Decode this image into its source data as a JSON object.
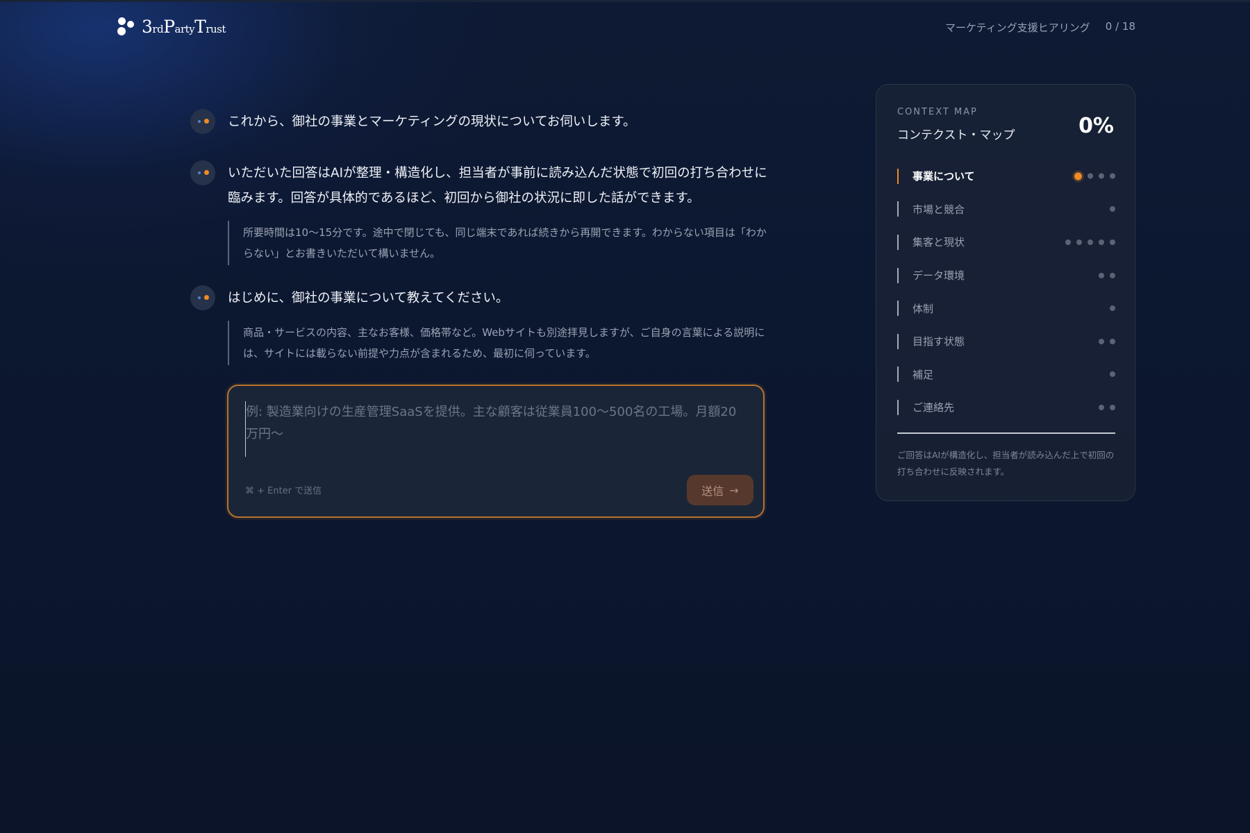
{
  "header": {
    "logo": {
      "t1": "3",
      "s1": "rd",
      "t2": "P",
      "s2": "arty",
      "t3": "T",
      "s3": "rust"
    },
    "survey_title": "マーケティング支援ヒアリング",
    "progress": "0 / 18"
  },
  "messages": [
    {
      "text": "これから、御社の事業とマーケティングの現状についてお伺いします。"
    },
    {
      "text": "いただいた回答はAIが整理・構造化し、担当者が事前に読み込んだ状態で初回の打ち合わせに臨みます。回答が具体的であるほど、初回から御社の状況に即した話ができます。",
      "note": "所要時間は10〜15分です。途中で閉じても、同じ端末であれば続きから再開できます。わからない項目は「わからない」とお書きいただいて構いません。"
    },
    {
      "text": "はじめに、御社の事業について教えてください。",
      "note": "商品・サービスの内容、主なお客様、価格帯など。Webサイトも別途拝見しますが、ご自身の言葉による説明には、サイトには載らない前提や力点が含まれるため、最初に伺っています。"
    }
  ],
  "input": {
    "value": "",
    "placeholder": "例: 製造業向けの生産管理SaaSを提供。主な顧客は従業員100〜500名の工場。月額20万円〜",
    "hint": "⌘ + Enter で送信",
    "send_label": "送信",
    "send_icon": "→"
  },
  "context_map": {
    "eyebrow": "CONTEXT MAP",
    "title": "コンテクスト・マップ",
    "percent": "0%",
    "items": [
      {
        "label": "事業について",
        "dots": 4,
        "active": true
      },
      {
        "label": "市場と競合",
        "dots": 1
      },
      {
        "label": "集客と現状",
        "dots": 5
      },
      {
        "label": "データ環境",
        "dots": 2
      },
      {
        "label": "体制",
        "dots": 1
      },
      {
        "label": "目指す状態",
        "dots": 2
      },
      {
        "label": "補足",
        "dots": 1
      },
      {
        "label": "ご連絡先",
        "dots": 2
      }
    ],
    "footnote": "ご回答はAIが構造化し、担当者が読み込んだ上で初回の打ち合わせに反映されます。"
  },
  "colors": {
    "accent": "#f08a24",
    "background": "#0c1730"
  }
}
